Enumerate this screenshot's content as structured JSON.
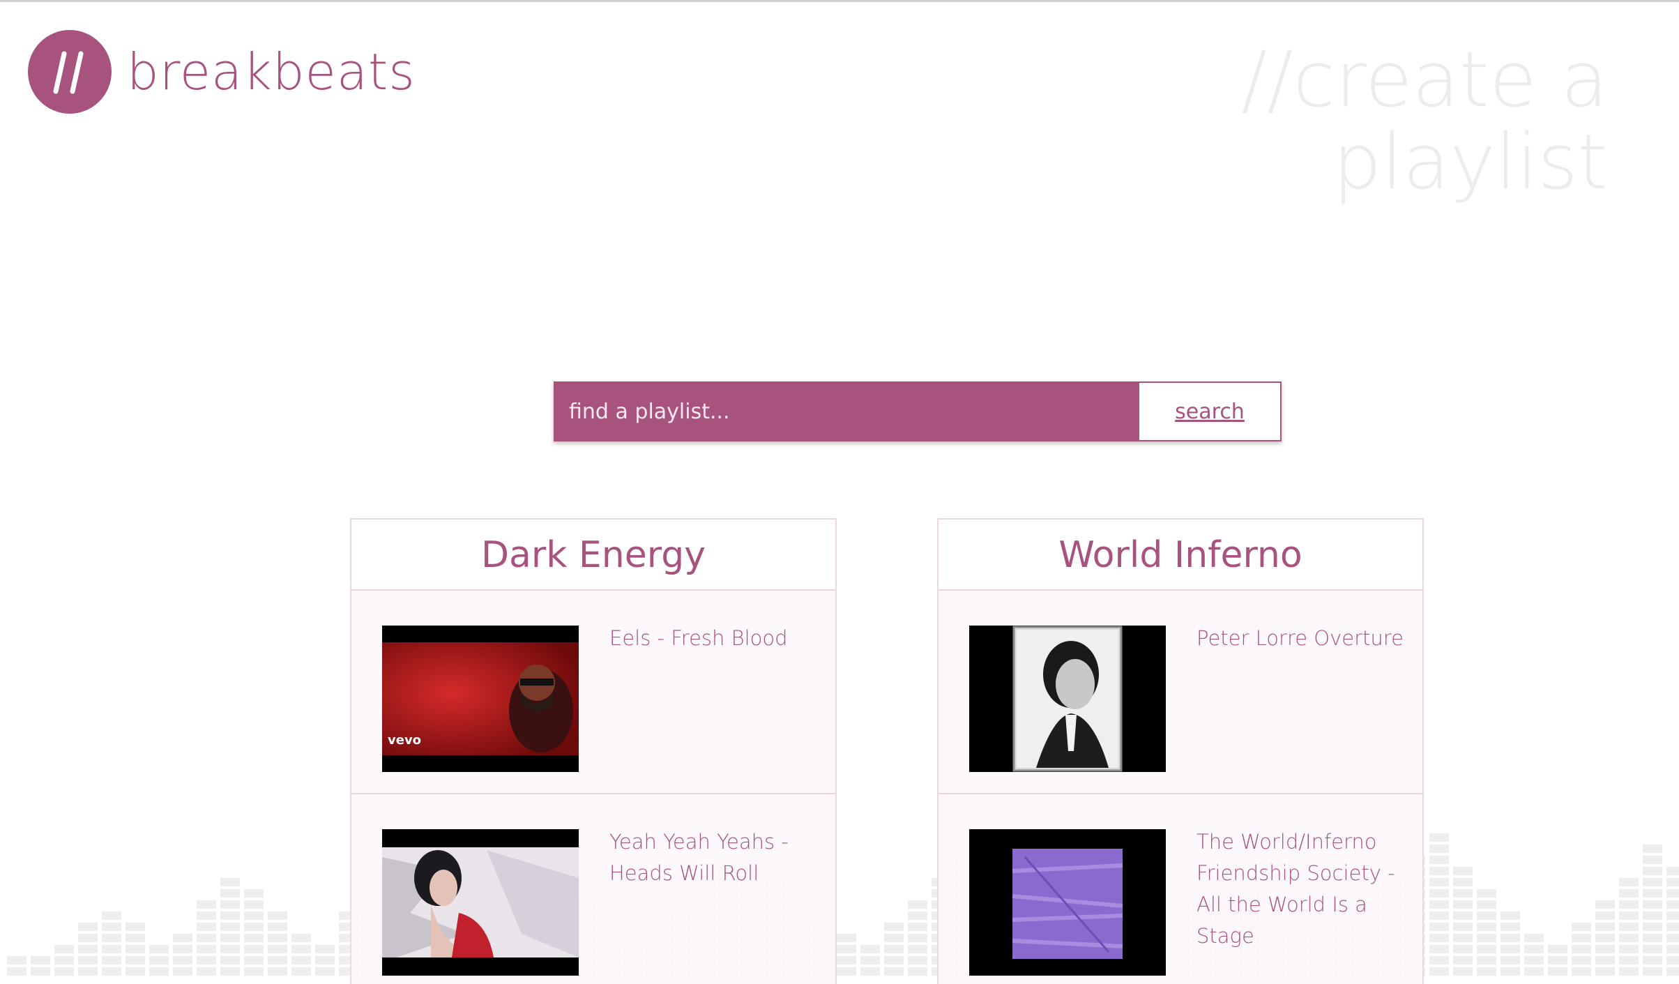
{
  "app": {
    "name": "breakbeats",
    "logo_mark": "//"
  },
  "hero": {
    "line1": "//create a",
    "line2": "playlist"
  },
  "search": {
    "placeholder": "find a playlist...",
    "button_label": "search"
  },
  "playlists": [
    {
      "title": "Dark Energy",
      "tracks": [
        {
          "title": "Eels - Fresh Blood",
          "thumb_badge": "vevo"
        },
        {
          "title": "Yeah Yeah Yeahs - Heads Will Roll"
        }
      ]
    },
    {
      "title": "World Inferno",
      "tracks": [
        {
          "title": "Peter Lorre Overture"
        },
        {
          "title": "The World/Inferno Friendship Society - All the World Is a Stage"
        }
      ]
    }
  ],
  "colors": {
    "accent": "#a8527e",
    "hero_text": "#ececec",
    "card_border": "#ecd6e1"
  }
}
